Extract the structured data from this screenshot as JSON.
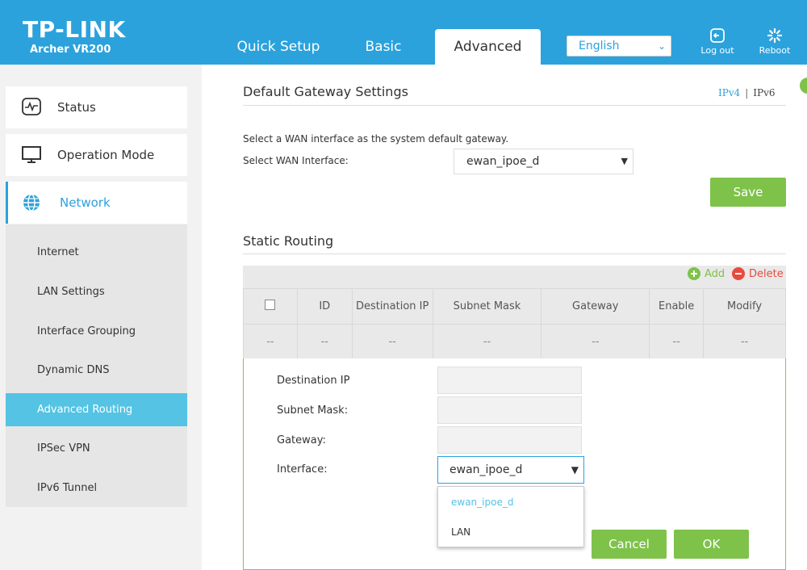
{
  "header": {
    "logo": "TP-LINK",
    "model": "Archer VR200",
    "tabs": [
      {
        "label": "Quick Setup",
        "active": false
      },
      {
        "label": "Basic",
        "active": false
      },
      {
        "label": "Advanced",
        "active": true
      }
    ],
    "language": "English",
    "logout_label": "Log out",
    "reboot_label": "Reboot"
  },
  "sidebar": {
    "menus": [
      {
        "label": "Status",
        "icon": "status-icon"
      },
      {
        "label": "Operation Mode",
        "icon": "monitor-icon"
      },
      {
        "label": "Network",
        "icon": "globe-icon",
        "active": true
      }
    ],
    "submenu": [
      {
        "label": "Internet"
      },
      {
        "label": "LAN Settings"
      },
      {
        "label": "Interface Grouping"
      },
      {
        "label": "Dynamic DNS"
      },
      {
        "label": "Advanced Routing",
        "active": true
      },
      {
        "label": "IPSec VPN"
      },
      {
        "label": "IPv6 Tunnel"
      }
    ]
  },
  "gateway": {
    "title": "Default Gateway Settings",
    "ipv4": "IPv4",
    "separator": "|",
    "ipv6": "IPv6",
    "description": "Select a WAN interface as the system default gateway.",
    "select_label": "Select WAN Interface:",
    "select_value": "ewan_ipoe_d",
    "save_label": "Save"
  },
  "routing": {
    "title": "Static Routing",
    "add_label": "Add",
    "delete_label": "Delete",
    "columns": [
      "ID",
      "Destination IP",
      "Subnet Mask",
      "Gateway",
      "Enable",
      "Modify"
    ],
    "empty_row": [
      "--",
      "--",
      "--",
      "--",
      "--",
      "--",
      "--"
    ],
    "form": {
      "dest_label": "Destination IP",
      "mask_label": "Subnet Mask:",
      "gateway_label": "Gateway:",
      "interface_label": "Interface:",
      "interface_value": "ewan_ipoe_d",
      "options": [
        "ewan_ipoe_d",
        "LAN"
      ],
      "cancel_label": "Cancel",
      "ok_label": "OK"
    }
  },
  "colors": {
    "brand_blue": "#2ba2dc",
    "accent_green": "#7ec24a",
    "delete_red": "#e84b3f",
    "active_sub": "#54c3e4"
  }
}
